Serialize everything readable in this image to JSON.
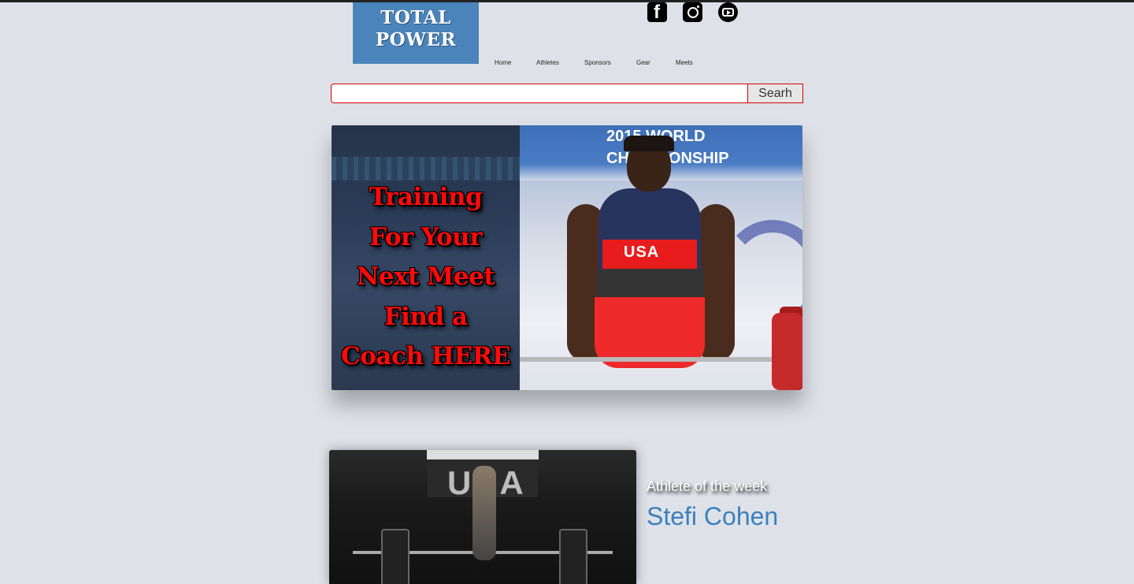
{
  "header": {
    "logo_line1": "TOTAL",
    "logo_line2": "POWER",
    "social_icons": [
      "facebook-icon",
      "instagram-icon",
      "youtube-icon"
    ],
    "nav": [
      "Home",
      "Athletes",
      "Sponsors",
      "Gear",
      "Meets"
    ]
  },
  "search": {
    "value": "",
    "button_label": "Searh"
  },
  "hero": {
    "lines": [
      "Training",
      "For Your",
      "Next Meet",
      "Find a",
      "Coach HERE"
    ],
    "banner_text": "2015 WORLD CHAMPIONSHIP",
    "shirt_text": "USA"
  },
  "feature": {
    "label": "Athlete of the week",
    "name": "Stefi Cohen",
    "sign_text": "USA"
  },
  "colors": {
    "background": "#dee2e8",
    "logo_bg": "#4a84bb",
    "accent_red": "#d40000",
    "athlete_name": "#3c80bd"
  }
}
